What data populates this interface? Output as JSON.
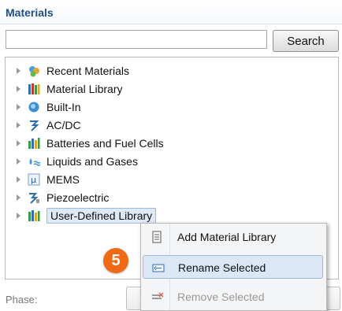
{
  "panel": {
    "title": "Materials"
  },
  "search": {
    "placeholder": "",
    "button_label": "Search"
  },
  "tree": {
    "items": [
      {
        "label": "Recent Materials",
        "icon": "recent-materials-icon"
      },
      {
        "label": "Material Library",
        "icon": "material-library-icon"
      },
      {
        "label": "Built-In",
        "icon": "built-in-icon"
      },
      {
        "label": "AC/DC",
        "icon": "acdc-icon"
      },
      {
        "label": "Batteries and Fuel Cells",
        "icon": "batteries-icon"
      },
      {
        "label": "Liquids and Gases",
        "icon": "liquids-gases-icon"
      },
      {
        "label": "MEMS",
        "icon": "mems-icon"
      },
      {
        "label": "Piezoelectric",
        "icon": "piezoelectric-icon"
      },
      {
        "label": "User-Defined Library",
        "icon": "user-library-icon"
      }
    ],
    "selected_index": 8
  },
  "context_menu": {
    "items": [
      {
        "label": "Add Material Library",
        "icon": "add-library-icon",
        "state": "normal"
      },
      {
        "label": "Rename Selected",
        "icon": "rename-icon",
        "state": "hover"
      },
      {
        "label": "Remove Selected",
        "icon": "remove-icon",
        "state": "disabled"
      }
    ]
  },
  "callout": {
    "number": "5"
  },
  "phase": {
    "label": "Phase:"
  },
  "colors": {
    "title": "#1f4f86",
    "badge": "#f06a16",
    "hover": "#dbe7f5"
  }
}
